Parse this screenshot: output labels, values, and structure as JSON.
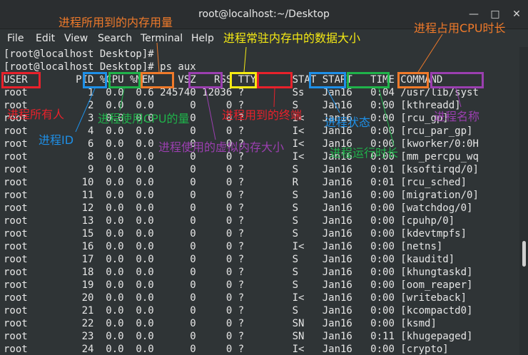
{
  "window": {
    "title": "root@localhost:~/Desktop",
    "minimize_glyph": "—",
    "maximize_glyph": "□",
    "close_glyph": "✕"
  },
  "menu": [
    "File",
    "Edit",
    "View",
    "Search",
    "Terminal",
    "Help"
  ],
  "terminal": {
    "lines": [
      "[root@localhost Desktop]#",
      "[root@localhost Desktop]# ps aux",
      "USER        PID %CPU %MEM    VSZ   RSS TTY      STAT START   TIME COMMAND",
      "root          1  0.0  0.6 245740 12036 ?        Ss   Jan16   0:04 /usr/lib/syst",
      "root          2  0.0  0.0      0     0 ?        S    Jan16   0:00 [kthreadd]",
      "root          3  0.0  0.0      0     0 ?        I<   Jan16   0:00 [rcu_gp]",
      "root          4  0.0  0.0      0     0 ?        I<   Jan16   0:00 [rcu_par_gp]",
      "root          6  0.0  0.0      0     0 ?        I<   Jan16   0:00 [kworker/0:0H",
      "root          8  0.0  0.0      0     0 ?        I<   Jan16   0:00 [mm_percpu_wq",
      "root          9  0.0  0.0      0     0 ?        S    Jan16   0:01 [ksoftirqd/0]",
      "root         10  0.0  0.0      0     0 ?        R    Jan16   0:01 [rcu_sched]",
      "root         11  0.0  0.0      0     0 ?        S    Jan16   0:00 [migration/0]",
      "root         12  0.0  0.0      0     0 ?        S    Jan16   0:00 [watchdog/0]",
      "root         13  0.0  0.0      0     0 ?        S    Jan16   0:00 [cpuhp/0]",
      "root         15  0.0  0.0      0     0 ?        S    Jan16   0:00 [kdevtmpfs]",
      "root         16  0.0  0.0      0     0 ?        I<   Jan16   0:00 [netns]",
      "root         17  0.0  0.0      0     0 ?        S    Jan16   0:00 [kauditd]",
      "root         18  0.0  0.0      0     0 ?        S    Jan16   0:00 [khungtaskd]",
      "root         19  0.0  0.0      0     0 ?        S    Jan16   0:00 [oom_reaper]",
      "root         20  0.0  0.0      0     0 ?        I<   Jan16   0:00 [writeback]",
      "root         21  0.0  0.0      0     0 ?        S    Jan16   0:00 [kcompactd0]",
      "root         22  0.0  0.0      0     0 ?        SN   Jan16   0:00 [ksmd]",
      "root         23  0.0  0.0      0     0 ?        SN   Jan16   0:11 [khugepaged]",
      "root         24  0.0  0.0      0     0 ?        I<   Jan16   0:00 [crypto]"
    ]
  },
  "annotations": {
    "user": "进程所有人",
    "pid": "进程ID",
    "cpu": "进程使用CPU的量",
    "mem": "进程所用到的内存用量",
    "vsz": "进程使用的虚拟内存大小",
    "rss": "进程常驻内存中的数据大小",
    "tty": "进程用到的终端",
    "stat": "进程状态",
    "start": "进程运行时长",
    "time": "进程占用CPU时长",
    "command": "进程名称"
  },
  "colors": {
    "red": "#e8212b",
    "blue": "#1e90e8",
    "green": "#1fb34a",
    "orange": "#f07a2a",
    "purple": "#9b3fb0",
    "yellow": "#f5ea14"
  }
}
